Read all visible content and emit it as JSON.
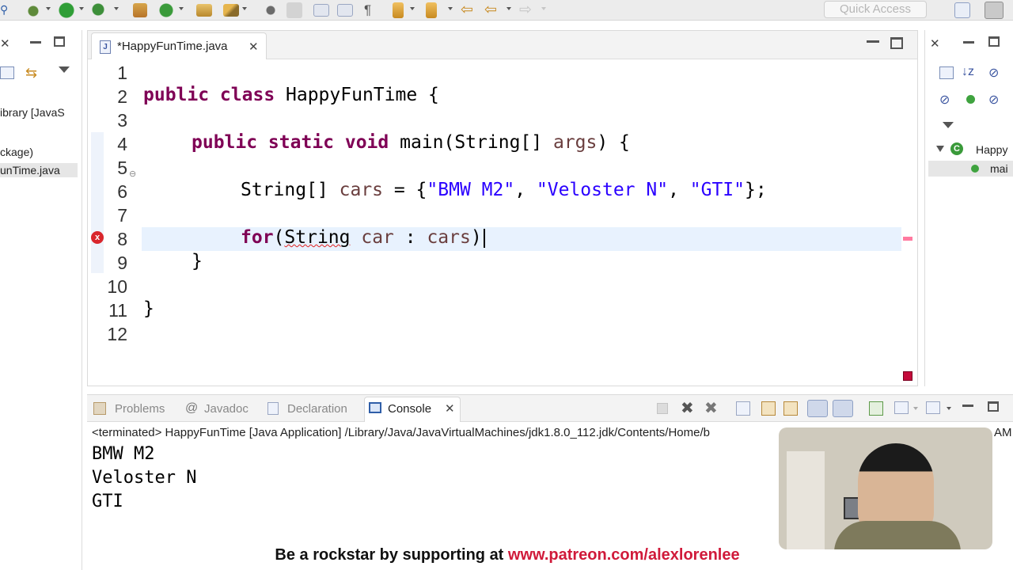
{
  "toolbar": {
    "quick_access_placeholder": "Quick Access",
    "icons": [
      "debug-icon",
      "run-icon",
      "external-tools-icon",
      "new-java-package-icon",
      "new-java-class-icon",
      "open-type-icon",
      "search-icon",
      "next-annotation-icon",
      "previous-annotation-icon",
      "back-icon",
      "forward-icon"
    ]
  },
  "left_panel": {
    "items": [
      "ibrary [JavaS",
      "ckage)",
      "unTime.java"
    ]
  },
  "editor": {
    "tab_title": "*HappyFunTime.java",
    "line_numbers": [
      "1",
      "2",
      "3",
      "4",
      "5",
      "6",
      "7",
      "8",
      "9",
      "10",
      "11",
      "12"
    ],
    "code": {
      "line2_kw": "public class",
      "line2_rest": " HappyFunTime {",
      "line4_kw": "public static void",
      "line4_rest1": " main(String[] ",
      "line4_var": "args",
      "line4_rest2": ") {",
      "line6_type": "String[] ",
      "line6_var": "cars",
      "line6_eq": " = {",
      "line6_s1": "\"BMW M2\"",
      "line6_comma1": ", ",
      "line6_s2": "\"Veloster N\"",
      "line6_comma2": ", ",
      "line6_s3": "\"GTI\"",
      "line6_end": "};",
      "line8_kw": "for",
      "line8_paren": "(",
      "line8_type": "String",
      "line8_rest1": " ",
      "line8_var": "car",
      "line8_rest2": " : ",
      "line8_var2": "cars",
      "line8_end": ")",
      "line9": "}",
      "line11": "}"
    },
    "error_marker": "x"
  },
  "right_panel": {
    "class_label": "Happy",
    "method_label": "mai"
  },
  "console": {
    "tabs": [
      "Problems",
      "Javadoc",
      "Declaration",
      "Console"
    ],
    "header": "<terminated> HappyFunTime [Java Application] /Library/Java/JavaVirtualMachines/jdk1.8.0_112.jdk/Contents/Home/b",
    "header_tail": "AM",
    "output": [
      "BMW M2",
      "Veloster N",
      "GTI"
    ]
  },
  "banner": {
    "text": "Be a rockstar by supporting at ",
    "link": "www.patreon.com/alexlorenlee"
  },
  "colors": {
    "keyword": "#7f0055",
    "string": "#2a00ff",
    "variable": "#6a3e3e",
    "error": "#d9262c",
    "banner_link": "#d01a3a"
  }
}
